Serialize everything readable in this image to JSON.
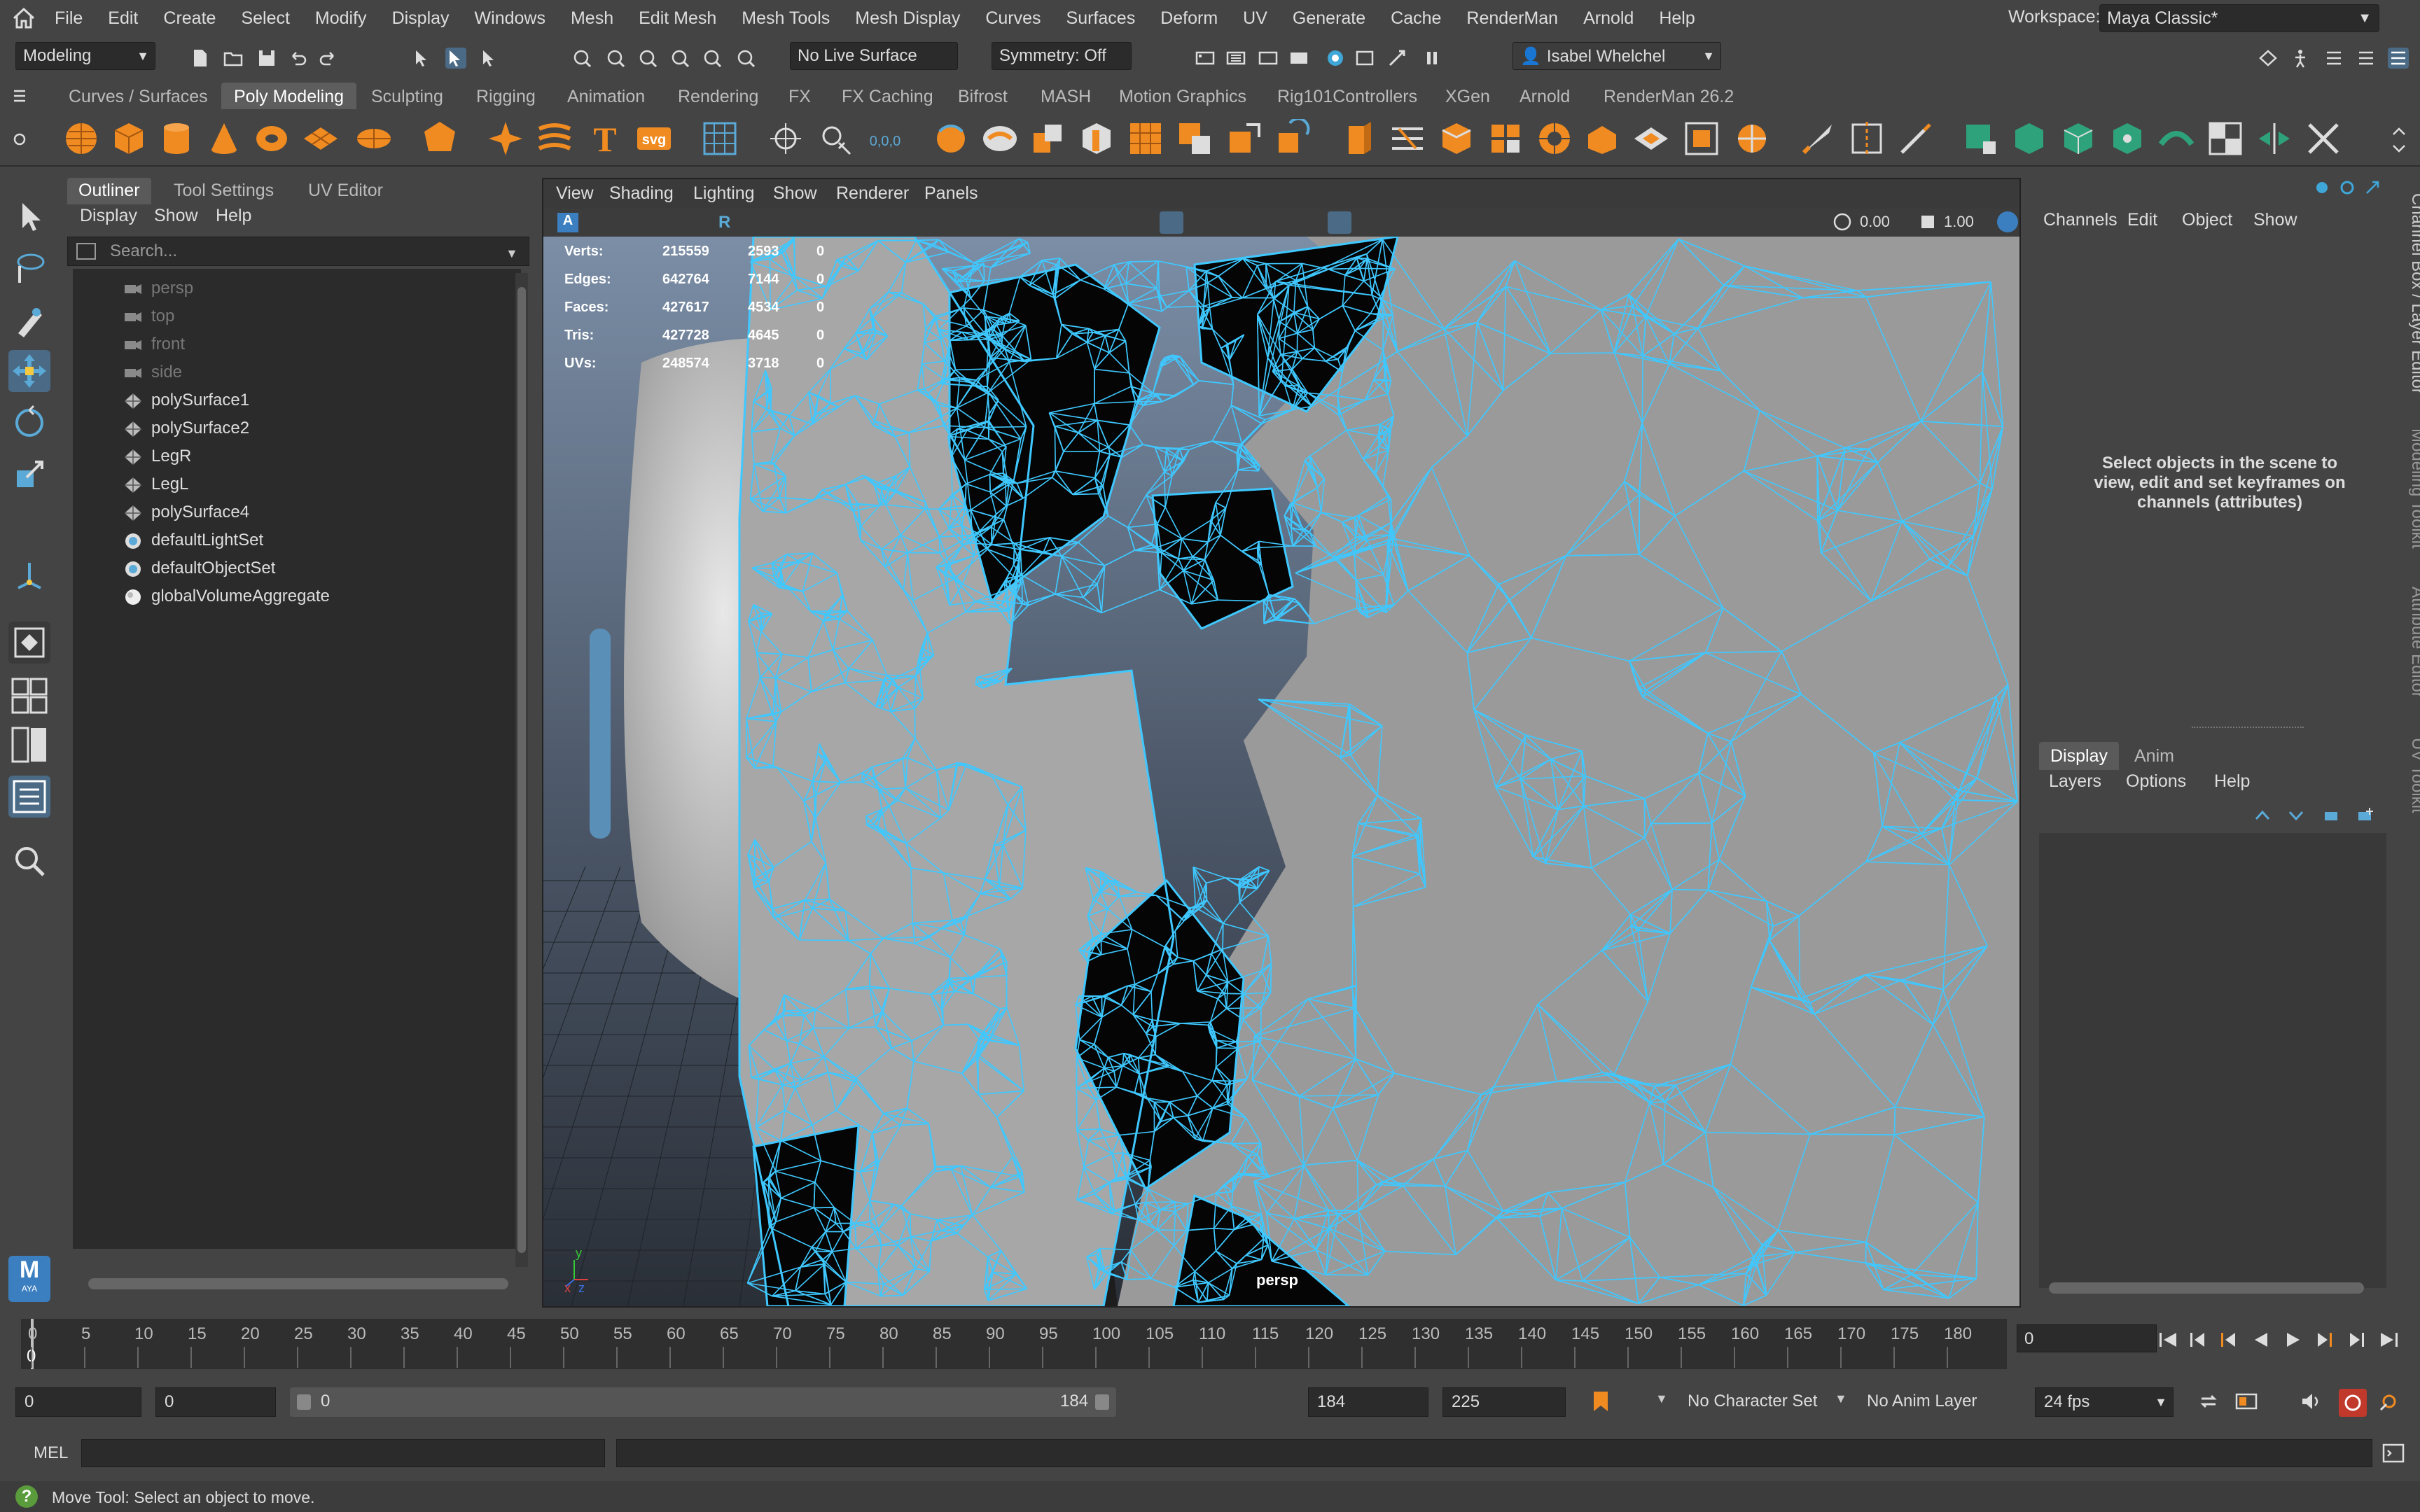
{
  "menubar": {
    "items": [
      "File",
      "Edit",
      "Create",
      "Select",
      "Modify",
      "Display",
      "Windows",
      "Mesh",
      "Edit Mesh",
      "Mesh Tools",
      "Mesh Display",
      "Curves",
      "Surfaces",
      "Deform",
      "UV",
      "Generate",
      "Cache",
      "RenderMan",
      "Arnold",
      "Help"
    ],
    "workspace_label": "Workspace:",
    "workspace_value": "Maya Classic*"
  },
  "statusline": {
    "mode": "Modeling",
    "live_surface": "No Live Surface",
    "symmetry": "Symmetry: Off",
    "user": "Isabel Whelchel"
  },
  "shelf": {
    "tabs": [
      "Curves / Surfaces",
      "Poly Modeling",
      "Sculpting",
      "Rigging",
      "Animation",
      "Rendering",
      "FX",
      "FX Caching",
      "Bifrost",
      "MASH",
      "Motion Graphics",
      "Rig101Controllers",
      "XGen",
      "Arnold",
      "RenderMan 26.2"
    ],
    "active_tab": "Poly Modeling",
    "text_icon_label": "T",
    "svg_icon_label": "svg",
    "coord_label": "0,0,0"
  },
  "outliner": {
    "tabs": [
      "Outliner",
      "Tool Settings",
      "UV Editor"
    ],
    "menu": [
      "Display",
      "Show",
      "Help"
    ],
    "search_placeholder": "Search...",
    "items": [
      {
        "label": "persp",
        "icon": "camera-icon",
        "dim": true
      },
      {
        "label": "top",
        "icon": "camera-icon",
        "dim": true
      },
      {
        "label": "front",
        "icon": "camera-icon",
        "dim": true
      },
      {
        "label": "side",
        "icon": "camera-icon",
        "dim": true
      },
      {
        "label": "polySurface1",
        "icon": "mesh-icon",
        "dim": false
      },
      {
        "label": "polySurface2",
        "icon": "mesh-icon",
        "dim": false
      },
      {
        "label": "LegR",
        "icon": "mesh-icon",
        "dim": false
      },
      {
        "label": "LegL",
        "icon": "mesh-icon",
        "dim": false
      },
      {
        "label": "polySurface4",
        "icon": "mesh-icon",
        "dim": false
      },
      {
        "label": "defaultLightSet",
        "icon": "set-icon",
        "dim": false
      },
      {
        "label": "defaultObjectSet",
        "icon": "set-icon",
        "dim": false
      },
      {
        "label": "globalVolumeAggregate",
        "icon": "volume-icon",
        "dim": false
      }
    ]
  },
  "viewport": {
    "menu": [
      "View",
      "Shading",
      "Lighting",
      "Show",
      "Renderer",
      "Panels"
    ],
    "exposure": "0.00",
    "gamma": "1.00",
    "camera_label": "persp",
    "hud": [
      {
        "label": "Verts:",
        "total": "215559",
        "selected": "2593",
        "other": "0"
      },
      {
        "label": "Edges:",
        "total": "642764",
        "selected": "7144",
        "other": "0"
      },
      {
        "label": "Faces:",
        "total": "427617",
        "selected": "4534",
        "other": "0"
      },
      {
        "label": "Tris:",
        "total": "427728",
        "selected": "4645",
        "other": "0"
      },
      {
        "label": "UVs:",
        "total": "248574",
        "selected": "3718",
        "other": "0"
      }
    ],
    "axis_labels": {
      "y": "y",
      "x": "x",
      "z": "z"
    }
  },
  "channelbox": {
    "menu": [
      "Channels",
      "Edit",
      "Object",
      "Show"
    ],
    "message_line1": "Select objects in the scene to",
    "message_line2": "view, edit and set keyframes on",
    "message_line3": "channels (attributes)",
    "layer_tabs": [
      "Display",
      "Anim"
    ],
    "layer_menu": [
      "Layers",
      "Options",
      "Help"
    ]
  },
  "side_tabs": [
    "Channel Box / Layer Editor",
    "Modeling Toolkit",
    "Attribute Editor",
    "UV Toolkit"
  ],
  "timeslider": {
    "ticks": [
      "0",
      "5",
      "10",
      "15",
      "20",
      "25",
      "30",
      "35",
      "40",
      "45",
      "50",
      "55",
      "60",
      "65",
      "70",
      "75",
      "80",
      "85",
      "90",
      "95",
      "100",
      "105",
      "110",
      "115",
      "120",
      "125",
      "130",
      "135",
      "140",
      "145",
      "150",
      "155",
      "160",
      "165",
      "170",
      "175",
      "180"
    ],
    "current_frame_marker": "0",
    "current_frame_field": "0"
  },
  "rangeslider": {
    "start_time": "0",
    "playback_start": "0",
    "range_start_label": "0",
    "range_end_label": "184",
    "playback_end": "184",
    "end_time": "225",
    "character_set": "No Character Set",
    "anim_layer": "No Anim Layer",
    "fps": "24 fps"
  },
  "cmdline": {
    "label": "MEL",
    "badge": "M",
    "badge_sub": "AYA"
  },
  "helpline": {
    "text": "Move Tool: Select an object to move."
  },
  "colors": {
    "wire": "#3fc8ff",
    "bg_gradient_top": "#7b8ea6",
    "bg_gradient_bottom": "#2a2f37",
    "mesh_gray": "#a7a7a7",
    "accent_orange": "#f08b22",
    "active_blue": "#4a6a85"
  }
}
